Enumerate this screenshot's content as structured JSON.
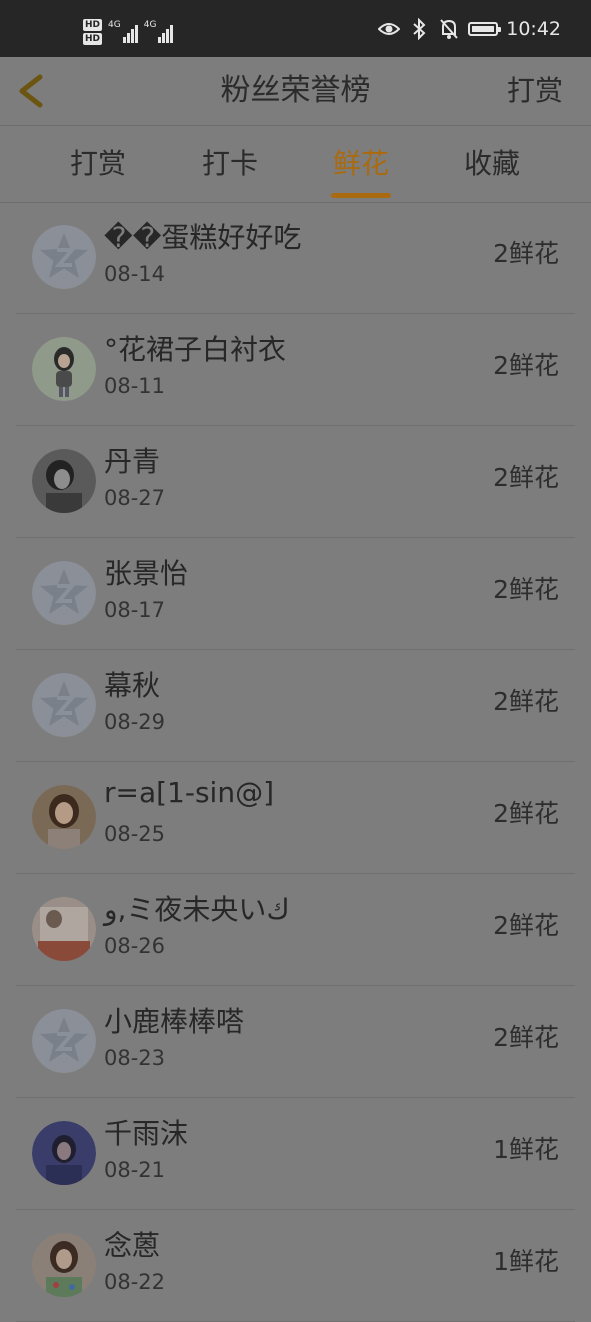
{
  "status_bar": {
    "hd1": "HD",
    "hd2": "HD",
    "net1": "4G",
    "net2": "4G",
    "time": "10:42",
    "icons": [
      "eye-icon",
      "bluetooth-icon",
      "bell-off-icon",
      "battery-icon"
    ]
  },
  "nav": {
    "title": "粉丝荣誉榜",
    "right_label": "打赏",
    "back_icon": "chevron-left-icon"
  },
  "tabs": [
    {
      "label": "打赏",
      "active": false
    },
    {
      "label": "打卡",
      "active": false
    },
    {
      "label": "鲜花",
      "active": true
    },
    {
      "label": "收藏",
      "active": false
    }
  ],
  "colors": {
    "accent": "#a96a10",
    "overlay_bg": "#7d7d7d"
  },
  "rows": [
    {
      "name": "��蛋糕好好吃",
      "date": "08-14",
      "amount": "2鲜花",
      "avatar": "default-star"
    },
    {
      "name": "°花裙子白衬衣",
      "date": "08-11",
      "amount": "2鲜花",
      "avatar": "photo-girl"
    },
    {
      "name": "丹青",
      "date": "08-27",
      "amount": "2鲜花",
      "avatar": "photo-bw"
    },
    {
      "name": "张景怡",
      "date": "08-17",
      "amount": "2鲜花",
      "avatar": "default-star"
    },
    {
      "name": "幕秋",
      "date": "08-29",
      "amount": "2鲜花",
      "avatar": "default-star"
    },
    {
      "name": "r=a[1-sin@]",
      "date": "08-25",
      "amount": "2鲜花",
      "avatar": "photo-woman"
    },
    {
      "name": "و,ミ夜未央いك",
      "date": "08-26",
      "amount": "2鲜花",
      "avatar": "photo-light"
    },
    {
      "name": "小鹿棒棒嗒",
      "date": "08-23",
      "amount": "2鲜花",
      "avatar": "default-star"
    },
    {
      "name": "千雨沫",
      "date": "08-21",
      "amount": "1鲜花",
      "avatar": "photo-blue"
    },
    {
      "name": "念蒽",
      "date": "08-22",
      "amount": "1鲜花",
      "avatar": "photo-colorful"
    }
  ]
}
